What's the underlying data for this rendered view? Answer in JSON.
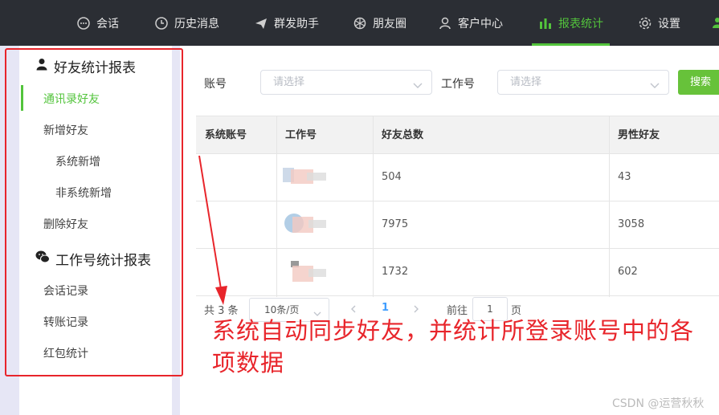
{
  "nav": {
    "items": [
      {
        "label": "会话",
        "icon": "chat-icon"
      },
      {
        "label": "历史消息",
        "icon": "clock-icon"
      },
      {
        "label": "群发助手",
        "icon": "send-icon"
      },
      {
        "label": "朋友圈",
        "icon": "aperture-icon"
      },
      {
        "label": "客户中心",
        "icon": "user-icon"
      },
      {
        "label": "报表统计",
        "icon": "bar-chart-icon"
      },
      {
        "label": "设置",
        "icon": "gear-icon"
      }
    ],
    "active": "报表统计",
    "accent": "#53c43c",
    "background": "#2b2e34"
  },
  "sidebar": {
    "groups": [
      {
        "title": "好友统计报表",
        "icon": "person-icon",
        "items": [
          {
            "label": "通讯录好友",
            "active": true
          },
          {
            "label": "新增好友"
          },
          {
            "label": "系统新增",
            "sub": true
          },
          {
            "label": "非系统新增",
            "sub": true
          },
          {
            "label": "删除好友"
          }
        ]
      },
      {
        "title": "工作号统计报表",
        "icon": "wechat-icon",
        "items": [
          {
            "label": "会话记录"
          },
          {
            "label": "转账记录"
          },
          {
            "label": "红包统计"
          }
        ]
      }
    ]
  },
  "filters": {
    "account_label": "账号",
    "account_placeholder": "请选择",
    "worknum_label": "工作号",
    "worknum_placeholder": "请选择",
    "search_label": "搜索"
  },
  "table": {
    "columns": [
      "系统账号",
      "工作号",
      "好友总数",
      "男性好友"
    ],
    "rows": [
      {
        "account": "",
        "worknum": "",
        "total": "504",
        "male": "43"
      },
      {
        "account": "",
        "worknum": "",
        "total": "7975",
        "male": "3058"
      },
      {
        "account": "",
        "worknum": "",
        "total": "1732",
        "male": "602"
      }
    ]
  },
  "pagination": {
    "total_text": "共 3 条",
    "page_size": "10条/页",
    "current_page": "1",
    "goto_label": "前往",
    "goto_value": "1",
    "page_suffix": "页"
  },
  "annotation": {
    "text": "系统自动同步好友，并统计所登录账号中的各项数据",
    "color": "#e8252b"
  },
  "watermark": "CSDN @运营秋秋"
}
